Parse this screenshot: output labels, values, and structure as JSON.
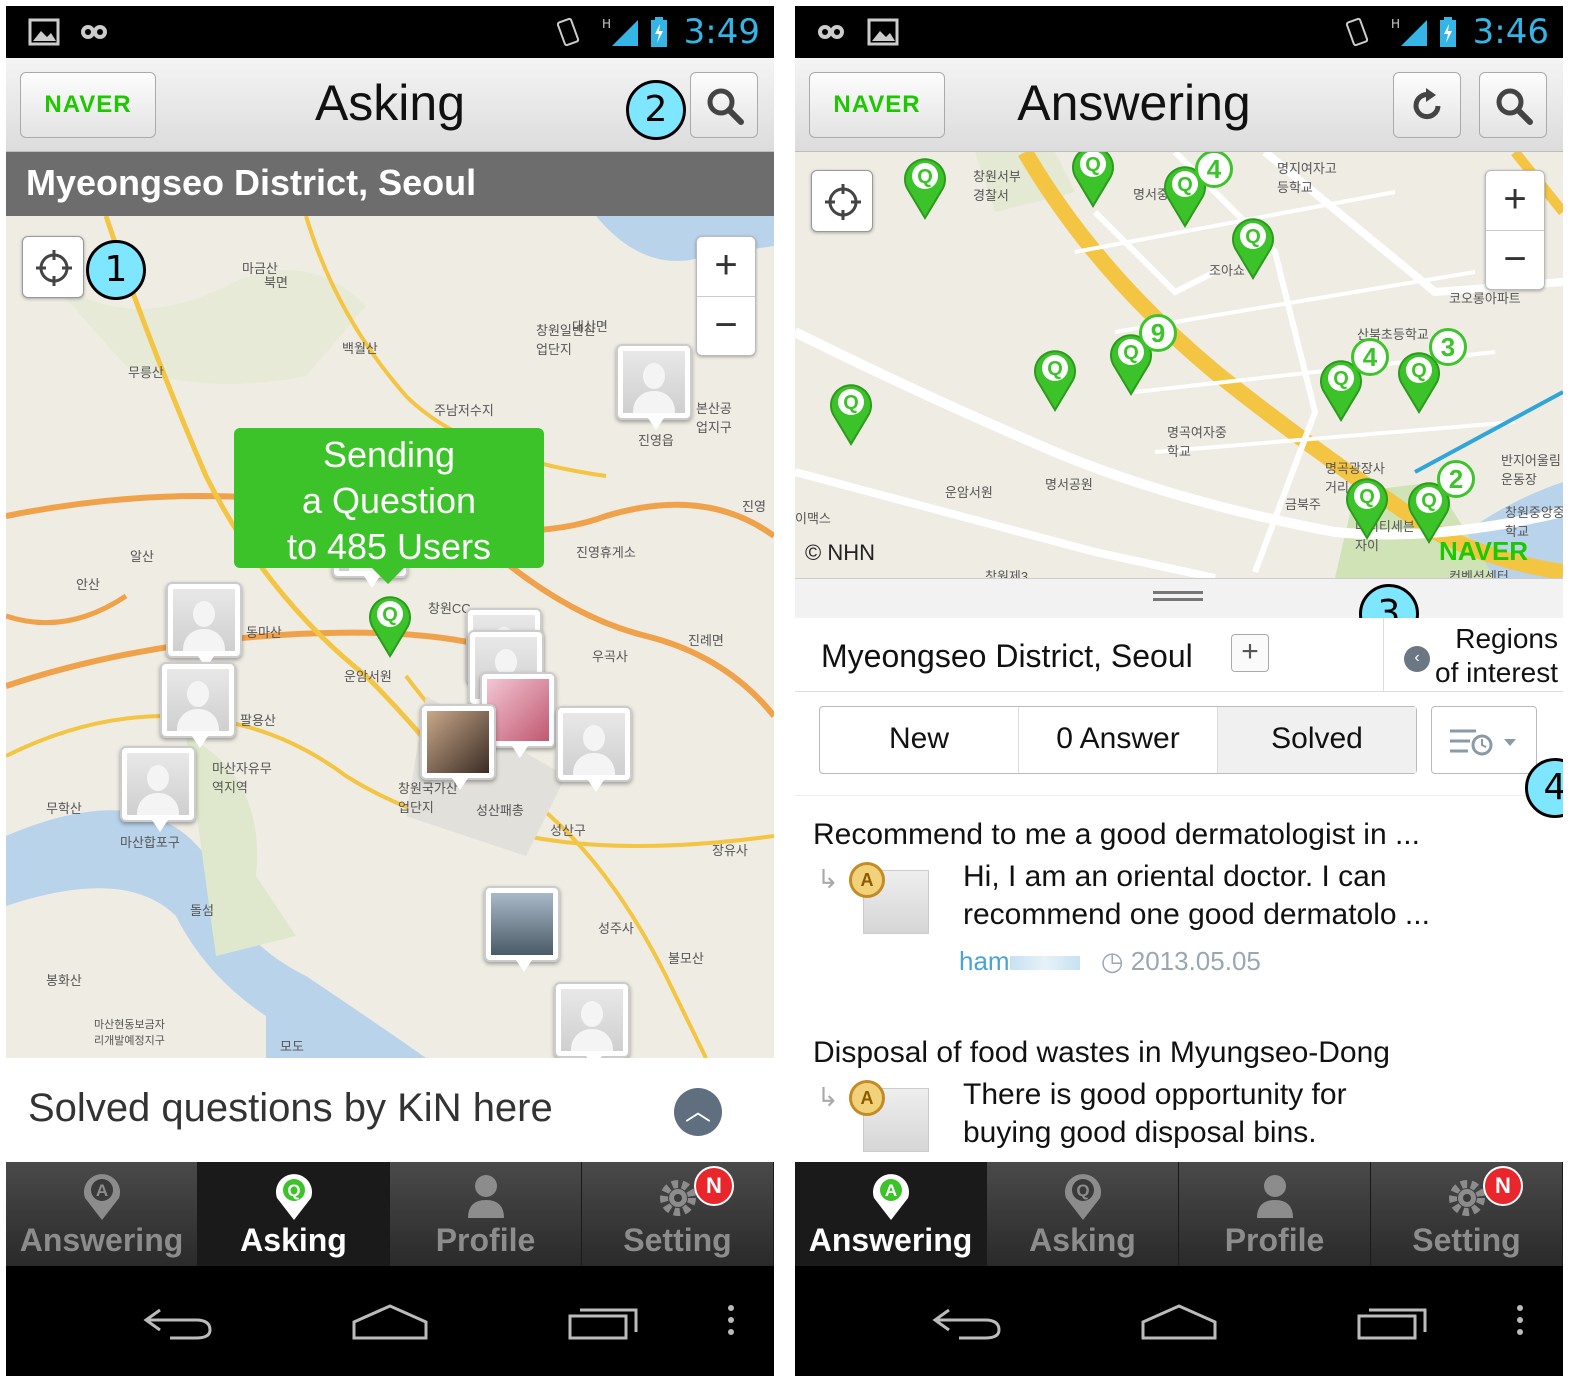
{
  "left": {
    "status_time": "3:49",
    "header": {
      "brand": "NAVER",
      "title": "Asking"
    },
    "callouts": {
      "one": "1",
      "two": "2"
    },
    "district": "Myeongseo District, Seoul",
    "zoom": {
      "plus": "+",
      "minus": "−"
    },
    "sending_bubble": {
      "line1": "Sending",
      "line2": "a Question",
      "line3": "to 485 Users"
    },
    "q_pin_label": "Q",
    "map_labels": [
      "마금산",
      "무릉산",
      "백월산",
      "주남저수지",
      "진영읍",
      "창원일반산업단지",
      "북면",
      "대산면",
      "알산",
      "안산",
      "진영휴게소",
      "창원CC",
      "우곡사",
      "동마산",
      "팔용산",
      "운암서원",
      "진례면",
      "마산자유무역지역",
      "무학산",
      "마산합포구",
      "창원국가산업단지",
      "성산패총",
      "성산구",
      "장유사",
      "돌섬",
      "성주사",
      "불모산",
      "봉화산",
      "마산현동보금자리개발예정지구",
      "모도",
      "진영",
      "본산공업지구"
    ],
    "solved_bar": "Solved questions by KiN here",
    "tabs": [
      {
        "label": "Answering",
        "icon": "A"
      },
      {
        "label": "Asking",
        "icon": "Q"
      },
      {
        "label": "Profile",
        "icon": ""
      },
      {
        "label": "Setting",
        "icon": "",
        "badge": "N"
      }
    ]
  },
  "right": {
    "status_time": "3:46",
    "header": {
      "brand": "NAVER",
      "title": "Answering"
    },
    "zoom": {
      "plus": "+",
      "minus": "−"
    },
    "map_copyright": "© NHN",
    "map_brand": "NAVER",
    "q_pin_label": "Q",
    "pin_counts": [
      "4",
      "9",
      "4",
      "3",
      "2"
    ],
    "map_labels": [
      "창원서부경찰서",
      "명서중",
      "명지여자고등학교",
      "조아쇼",
      "코오롱아파트",
      "산북초등학교",
      "반지어울림운동장",
      "명곡여자중학교",
      "명서공원",
      "운암서원",
      "명곡광장사거리",
      "금북주",
      "더시티세븐자이",
      "창원중앙중학교",
      "컨벤션센터",
      "창원제3",
      "이맥스"
    ],
    "callouts": {
      "three": "3",
      "four": "4"
    },
    "region": {
      "name": "Myeongseo District, Seoul",
      "add": "+",
      "roi_line1": "Regions",
      "roi_line2": "of interest"
    },
    "filters": [
      "New",
      "0 Answer",
      "Solved"
    ],
    "questions": [
      {
        "title": "Recommend to me a good dermatologist in ...",
        "medal": "A",
        "answer": "Hi, I am an oriental doctor. I can recommend one good dermatolo ...",
        "user": "ham",
        "date": "2013.05.05"
      },
      {
        "title": "Disposal of food wastes in Myungseo-Dong",
        "medal": "A",
        "answer": "There is good opportunity for buying good disposal bins."
      }
    ],
    "tabs": [
      {
        "label": "Answering",
        "icon": "A"
      },
      {
        "label": "Asking",
        "icon": "Q"
      },
      {
        "label": "Profile",
        "icon": ""
      },
      {
        "label": "Setting",
        "icon": "",
        "badge": "N"
      }
    ]
  },
  "colors": {
    "brand_green": "#1ec800",
    "pin_green": "#3dc32a",
    "callout_blue": "#7ee7ff",
    "status_blue": "#35b5e5",
    "badge_red": "#e8262b"
  }
}
